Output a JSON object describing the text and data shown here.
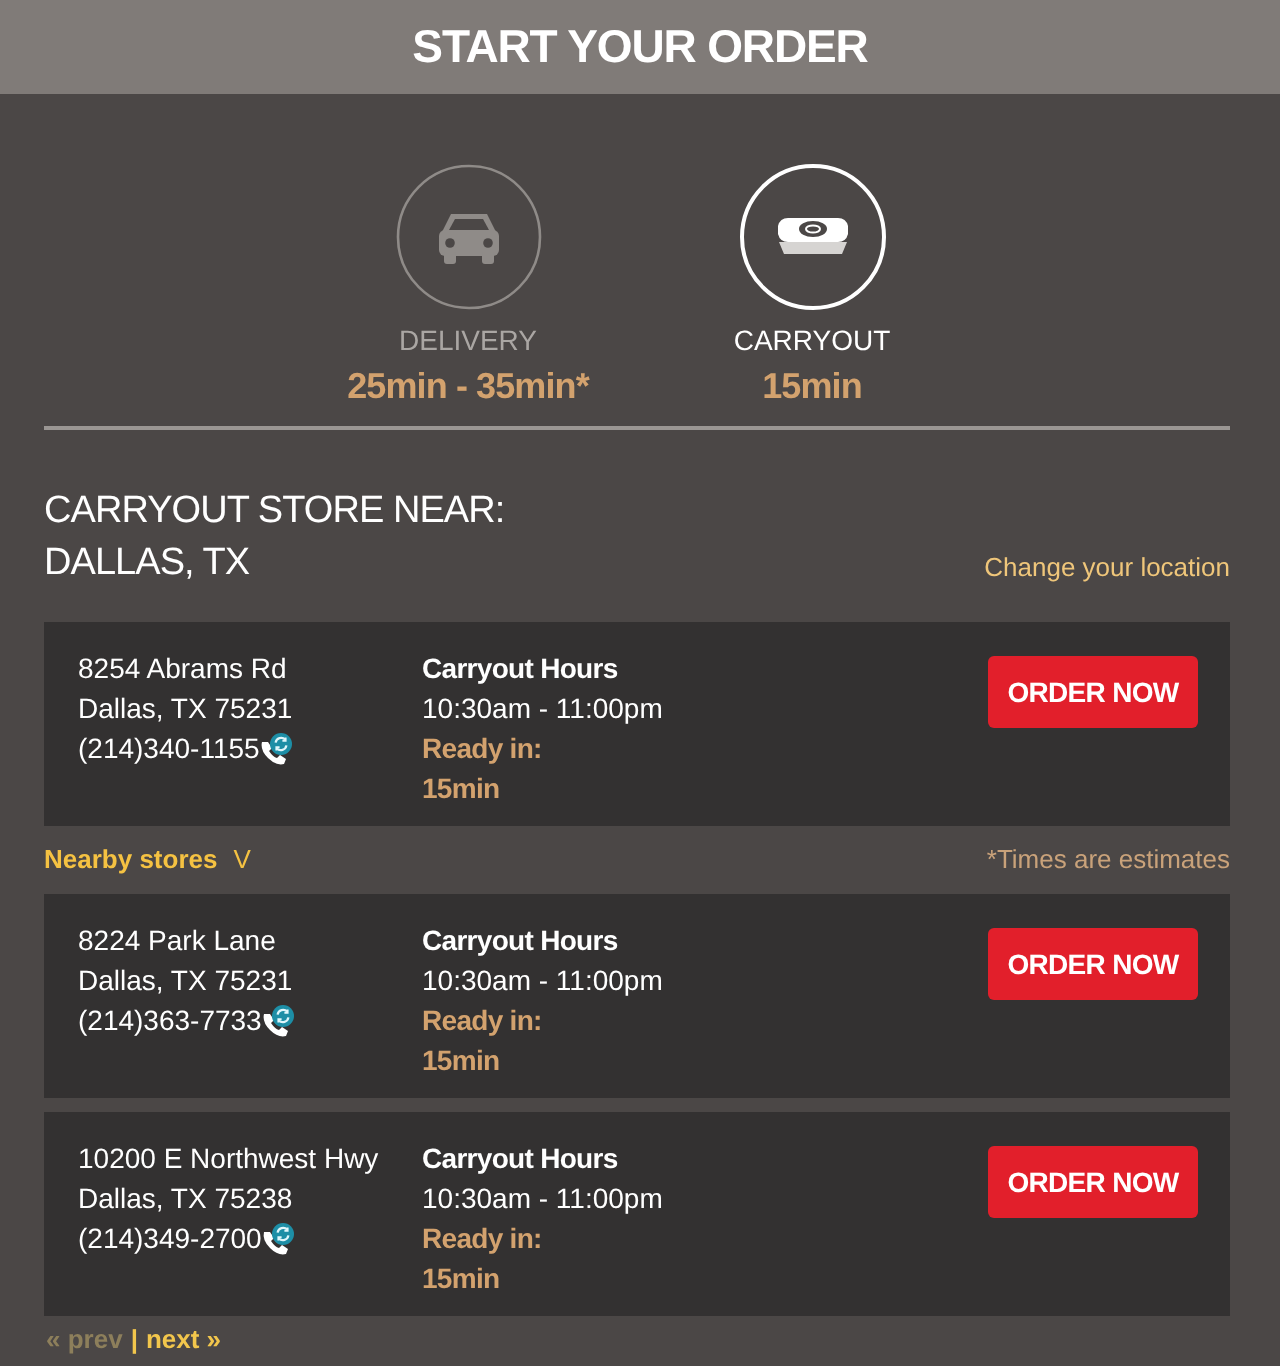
{
  "header": {
    "title": "START YOUR ORDER"
  },
  "service_options": [
    {
      "kind": "delivery",
      "label": "DELIVERY",
      "time": "25min - 35min*",
      "selected": false
    },
    {
      "kind": "carryout",
      "label": "CARRYOUT",
      "time": "15min",
      "selected": true
    }
  ],
  "location": {
    "heading": "CARRYOUT STORE NEAR:",
    "city": "DALLAS, TX",
    "change_link": "Change your location"
  },
  "store": {
    "address": "8254 Abrams Rd",
    "city_line": "Dallas, TX 75231",
    "phone": "(214)340-1155",
    "hours_label": "Carryout Hours",
    "hours": "10:30am - 11:00pm",
    "ready_label": "Ready in:",
    "ready_time": "15min",
    "button": "ORDER NOW"
  },
  "nearby": {
    "label": "Nearby stores",
    "toggle": "V",
    "note": "*Times are estimates"
  },
  "nearby_stores": [
    {
      "address": "8224 Park Lane",
      "city_line": "Dallas, TX 75231",
      "phone": "(214)363-7733",
      "hours_label": "Carryout Hours",
      "hours": "10:30am - 11:00pm",
      "ready_label": "Ready in:",
      "ready_time": "15min",
      "button": "ORDER NOW"
    },
    {
      "address": "10200 E Northwest Hwy",
      "city_line": "Dallas, TX 75238",
      "phone": "(214)349-2700",
      "hours_label": "Carryout Hours",
      "hours": "10:30am - 11:00pm",
      "ready_label": "Ready in:",
      "ready_time": "15min",
      "button": "ORDER NOW"
    }
  ],
  "pagination": {
    "prev": {
      "label": "« prev",
      "disabled": true
    },
    "separator": "|",
    "next": {
      "label": "next »",
      "disabled": false
    }
  }
}
